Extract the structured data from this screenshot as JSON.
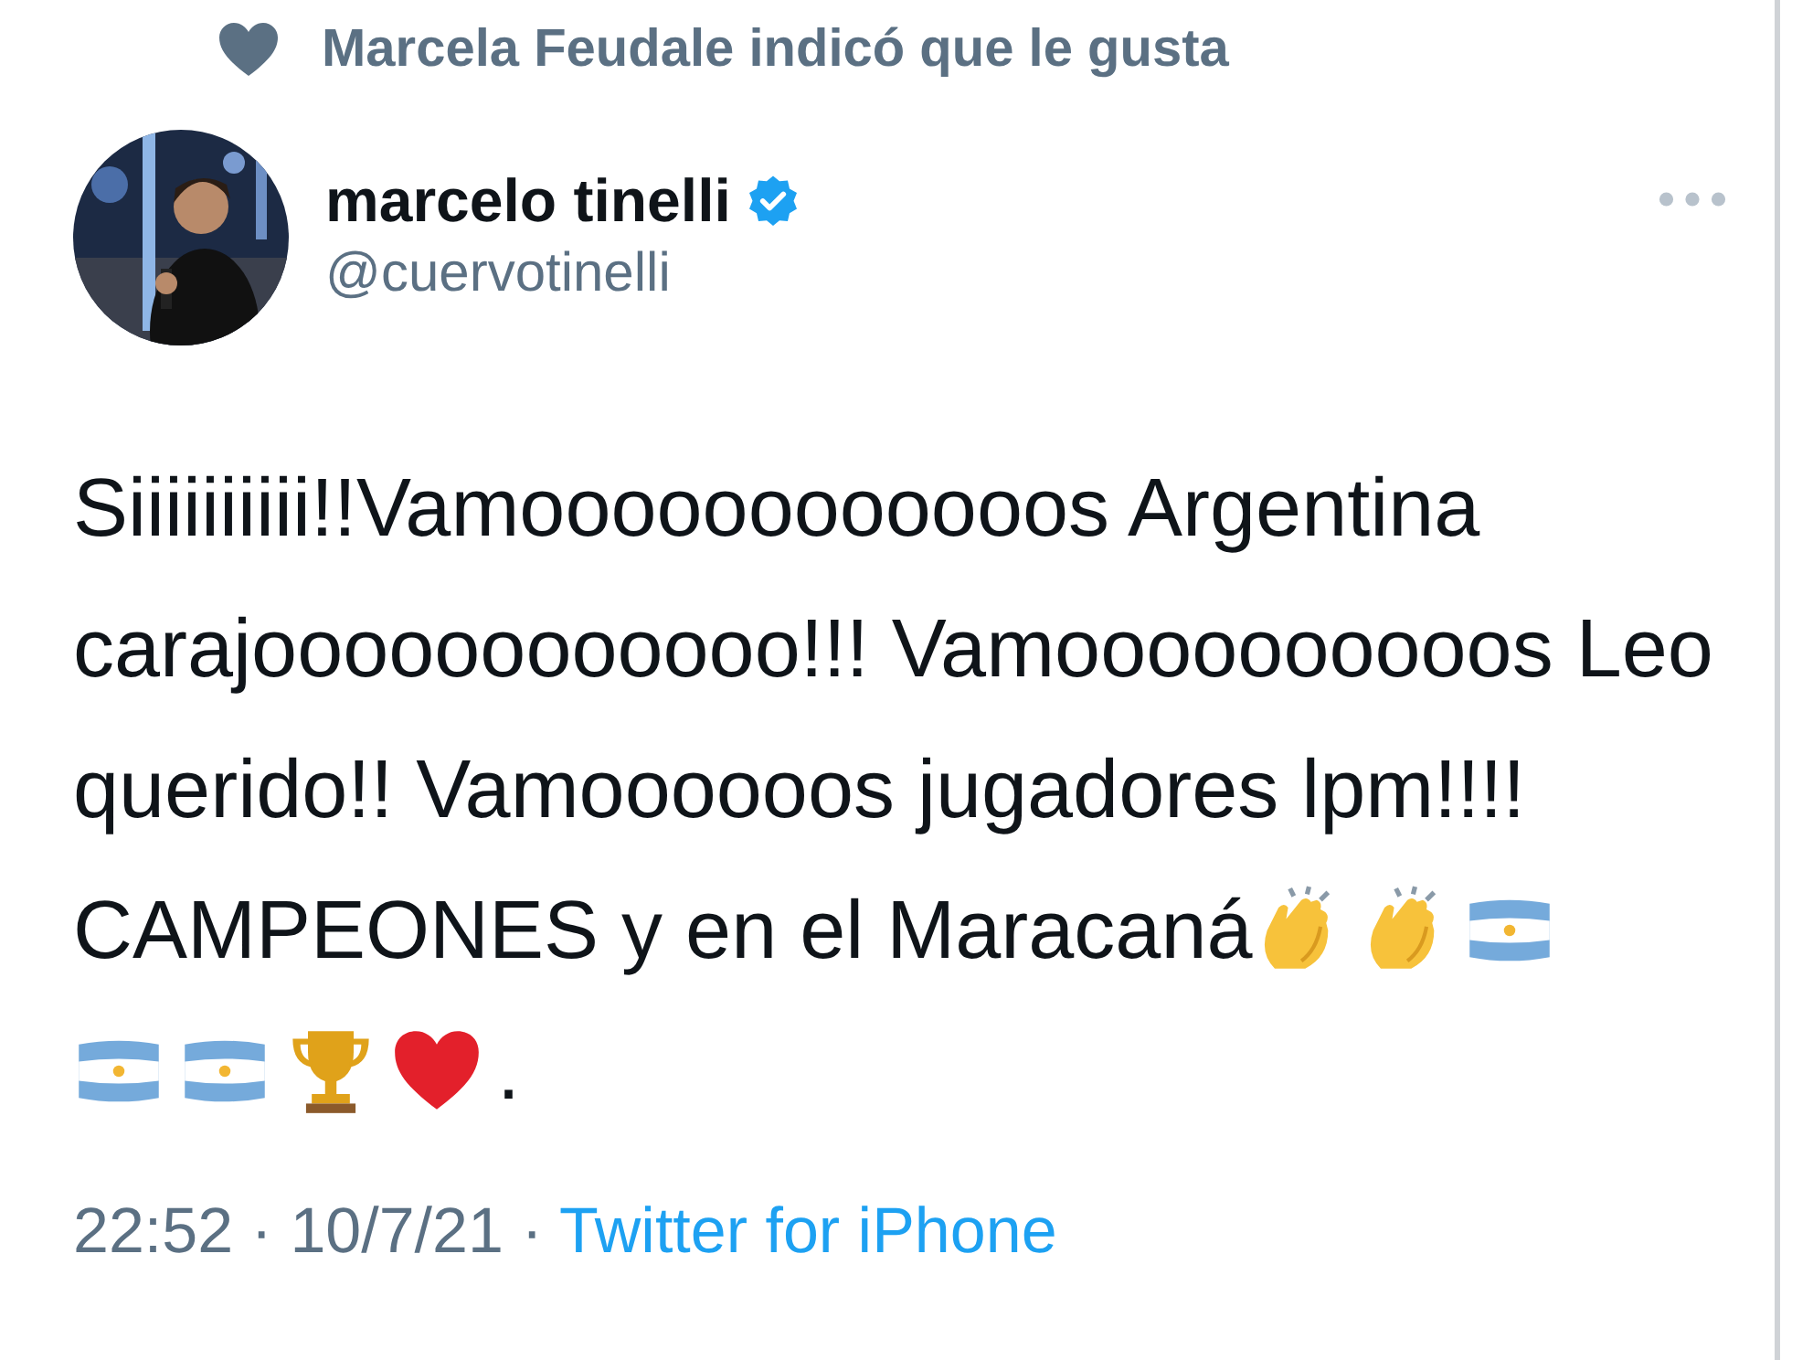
{
  "social_context": {
    "text": "Marcela Feudale indicó que le gusta"
  },
  "author": {
    "name": "marcelo tinelli",
    "verified": true,
    "handle": "@cuervotinelli"
  },
  "tweet": {
    "lines": [
      [
        {
          "kind": "text",
          "text": "Siiiiiiiiii!!Vamoooooooooooos Argentina"
        }
      ],
      [
        {
          "kind": "text",
          "text": "carajoooooooooooo!!! Vamoooooooooos Leo"
        }
      ],
      [
        {
          "kind": "text",
          "text": "querido!! Vamoooooos jugadores lpm!!!!"
        }
      ],
      [
        {
          "kind": "text",
          "text": "CAMPEONES y en el Maracaná"
        },
        {
          "kind": "clap"
        },
        {
          "kind": "clap"
        },
        {
          "kind": "flag"
        }
      ],
      [
        {
          "kind": "flag"
        },
        {
          "kind": "flag"
        },
        {
          "kind": "trophy"
        },
        {
          "kind": "heart"
        },
        {
          "kind": "text",
          "text": "."
        }
      ]
    ]
  },
  "footer": {
    "time": "22:52 · 10/7/21 · ",
    "source": "Twitter for iPhone"
  }
}
